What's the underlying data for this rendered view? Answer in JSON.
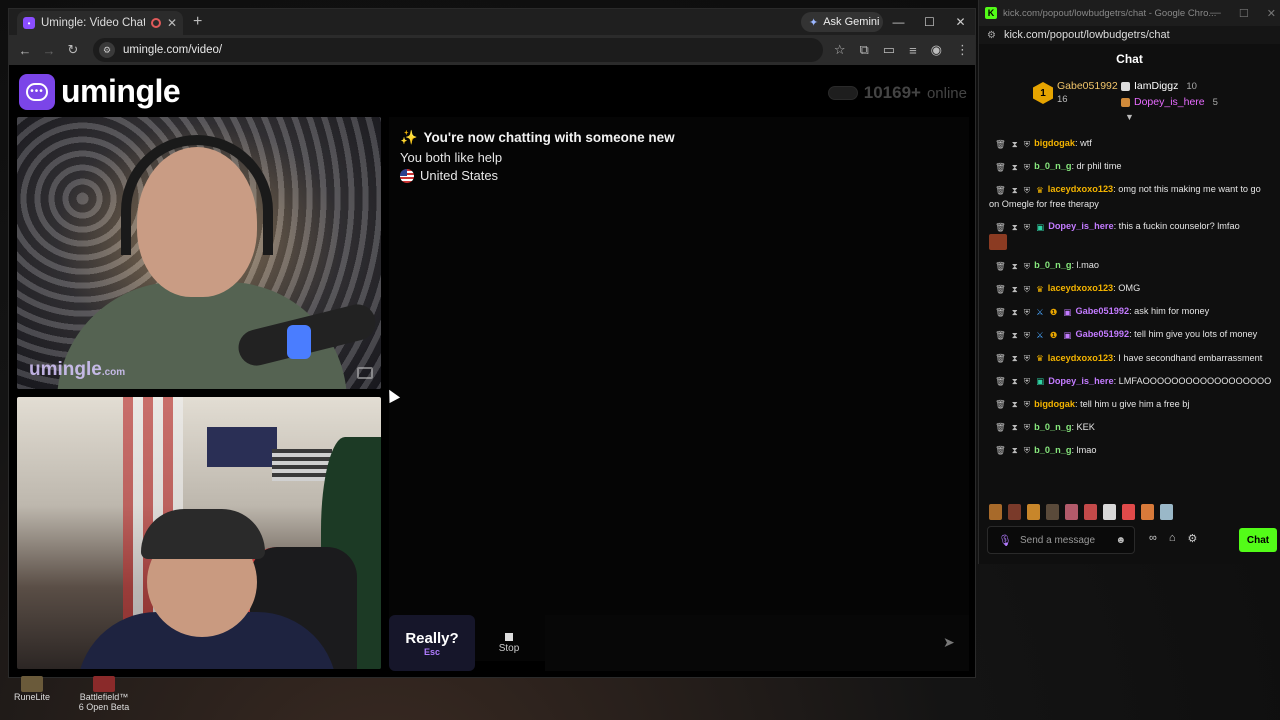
{
  "browser": {
    "tab_title": "Umingle: Video Chat with S",
    "url": "umingle.com/video/",
    "gemini_label": "Ask Gemini"
  },
  "site": {
    "logo_text": "umingle",
    "online_count": "10169+",
    "online_label": "online",
    "watermark": "umingle",
    "watermark_suffix": ".com"
  },
  "chat": {
    "status_line": "You're now chatting with someone new",
    "interest_line": "You both like help",
    "country": "United States"
  },
  "controls": {
    "skip_label": "Really?",
    "skip_key": "Esc",
    "stop_label": "Stop"
  },
  "taskbar": {
    "items": [
      {
        "label": "RuneLite"
      },
      {
        "label": "Battlefield™ 6 Open Beta"
      }
    ]
  },
  "kick": {
    "window_title": "kick.com/popout/lowbudgetrs/chat - Google Chro...",
    "url": "kick.com/popout/lowbudgetrs/chat",
    "chat_title": "Chat",
    "leaderboard": {
      "first": {
        "name": "Gabe051992",
        "count": "16"
      },
      "second": {
        "name": "IamDiggz",
        "count": "10"
      },
      "third": {
        "name": "Dopey_is_here",
        "count": "5"
      }
    },
    "messages": [
      {
        "user": "bigdogak",
        "text": ": wtf",
        "color": "orange"
      },
      {
        "user": "b_0_n_g",
        "text": ": dr phil time",
        "color": "green"
      },
      {
        "user": "laceydxoxo123",
        "text": ": omg not this making me want to go on Omegle for free therapy",
        "color": "orange"
      },
      {
        "user": "Dopey_is_here",
        "text": ": this a fuckin counselor? lmfao",
        "color": "purple"
      },
      {
        "user": "b_0_n_g",
        "text": ": l.mao",
        "color": "green"
      },
      {
        "user": "laceydxoxo123",
        "text": ": OMG",
        "color": "orange"
      },
      {
        "user": "Gabe051992",
        "text": ": ask him for money",
        "color": "purple"
      },
      {
        "user": "Gabe051992",
        "text": ": tell him give you lots of money",
        "color": "purple"
      },
      {
        "user": "laceydxoxo123",
        "text": ": I have secondhand embarrassment",
        "color": "orange"
      },
      {
        "user": "Dopey_is_here",
        "text": ": LMFAOOOOOOOOOOOOOOOOOO",
        "color": "purple"
      },
      {
        "user": "bigdogak",
        "text": ": tell him u give him a free bj",
        "color": "orange"
      },
      {
        "user": "b_0_n_g",
        "text": ": KEK",
        "color": "green"
      },
      {
        "user": "b_0_n_g",
        "text": ": lmao",
        "color": "green"
      }
    ],
    "input_placeholder": "Send a message",
    "send_label": "Chat"
  }
}
